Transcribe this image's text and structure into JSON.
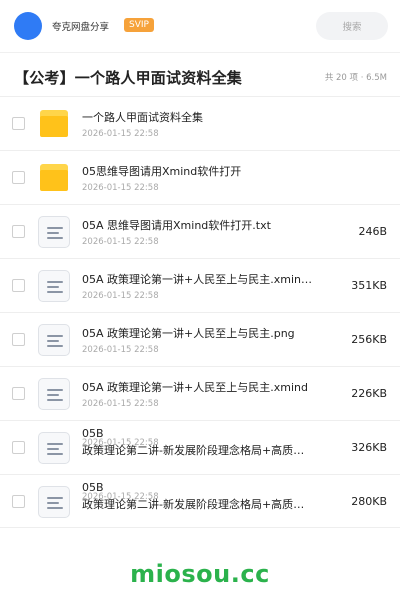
{
  "header": {
    "app_name": "夸克网盘分享",
    "badge": "SVIP",
    "search_placeholder": "搜索"
  },
  "title": "【公考】一个路人甲面试资料全集",
  "meta": "共 20 项 · 6.5M",
  "files": [
    {
      "type": "folder",
      "name": "一个路人甲面试资料全集",
      "date": "2026-01-15 22:58",
      "size": ""
    },
    {
      "type": "folder",
      "name": "05思维导图请用Xmind软件打开",
      "date": "2026-01-15 22:58",
      "size": ""
    },
    {
      "type": "doc",
      "name": "05A 思维导图请用Xmind软件打开.txt",
      "date": "2026-01-15 22:58",
      "size": "246B"
    },
    {
      "type": "doc",
      "name": "05A 政策理论第一讲+人民至上与民主.xmind…",
      "date": "2026-01-15 22:58",
      "size": "351KB"
    },
    {
      "type": "doc",
      "name": "05A 政策理论第一讲+人民至上与民主.png",
      "date": "2026-01-15 22:58",
      "size": "256KB"
    },
    {
      "type": "doc",
      "name": "05A 政策理论第一讲+人民至上与民主.xmind",
      "date": "2026-01-15 22:58",
      "size": "226KB"
    },
    {
      "type": "doc",
      "name_line1": "05B",
      "name_line2": "政策理论第二讲-新发展阶段理念格局+高质量…",
      "date": "2026-01-15 22:58",
      "size": "326KB"
    },
    {
      "type": "doc",
      "name_line1": "05B",
      "name_line2": "政策理论第二讲-新发展阶段理念格局+高质量…",
      "date": "2026-01-15 22:58",
      "size": "280KB"
    }
  ],
  "watermark": "miosou.cc",
  "colors": {
    "avatar": "#2f7bf5",
    "badge": "#f6a23a",
    "folder": "#ffc21a",
    "watermark": "#2bb24c"
  }
}
